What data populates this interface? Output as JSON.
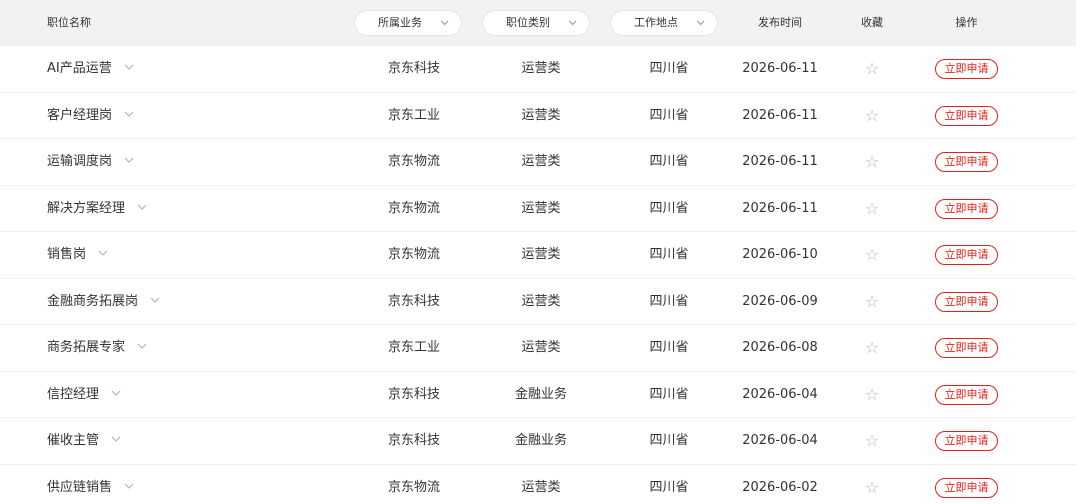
{
  "header": {
    "name": "职位名称",
    "business_filter": "所属业务",
    "category_filter": "职位类别",
    "location_filter": "工作地点",
    "publish_time": "发布时间",
    "favorite": "收藏",
    "actions": "操作"
  },
  "apply_label": "立即申请",
  "star_glyph": "☆",
  "rows": [
    {
      "name": "AI产品运营",
      "business": "京东科技",
      "category": "运营类",
      "location": "四川省",
      "date": "2026-06-11"
    },
    {
      "name": "客户经理岗",
      "business": "京东工业",
      "category": "运营类",
      "location": "四川省",
      "date": "2026-06-11"
    },
    {
      "name": "运输调度岗",
      "business": "京东物流",
      "category": "运营类",
      "location": "四川省",
      "date": "2026-06-11"
    },
    {
      "name": "解决方案经理",
      "business": "京东物流",
      "category": "运营类",
      "location": "四川省",
      "date": "2026-06-11"
    },
    {
      "name": "销售岗",
      "business": "京东物流",
      "category": "运营类",
      "location": "四川省",
      "date": "2026-06-10"
    },
    {
      "name": "金融商务拓展岗",
      "business": "京东科技",
      "category": "运营类",
      "location": "四川省",
      "date": "2026-06-09"
    },
    {
      "name": "商务拓展专家",
      "business": "京东工业",
      "category": "运营类",
      "location": "四川省",
      "date": "2026-06-08"
    },
    {
      "name": "信控经理",
      "business": "京东科技",
      "category": "金融业务",
      "location": "四川省",
      "date": "2026-06-04"
    },
    {
      "name": "催收主管",
      "business": "京东科技",
      "category": "金融业务",
      "location": "四川省",
      "date": "2026-06-04"
    },
    {
      "name": "供应链销售",
      "business": "京东物流",
      "category": "运营类",
      "location": "四川省",
      "date": "2026-06-02"
    }
  ],
  "colors": {
    "header_bg": "#f1f2f4",
    "accent_red": "#e2231a",
    "star_gray": "#b5b5b5"
  },
  "icons": {
    "filter_chevron": "chevron-down-icon",
    "row_expand": "chevron-down-icon",
    "favorite": "star-outline-icon"
  }
}
